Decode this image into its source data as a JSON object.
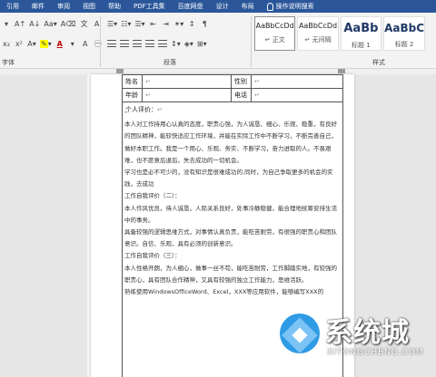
{
  "tabs": [
    "引用",
    "邮件",
    "审阅",
    "视图",
    "帮助",
    "PDF工具集",
    "百度网盘",
    "设计",
    "布局"
  ],
  "active_tab": "设计",
  "tell_me": "操作说明搜索",
  "ribbon": {
    "font_group_label": "字体",
    "paragraph_group_label": "段落",
    "styles_group_label": "样式",
    "styles": [
      {
        "sample": "AaBbCcDd",
        "name": "↵ 正文"
      },
      {
        "sample": "AaBbCcDd",
        "name": "↵ 无间隔"
      },
      {
        "sample": "AaBb",
        "name": "标题 1"
      },
      {
        "sample": "AaBbC",
        "name": "标题 2"
      }
    ]
  },
  "form": {
    "name_label": "姓名",
    "gender_label": "性别",
    "age_label": "年龄",
    "phone_label": "电话",
    "personal_eval": "个人评价："
  },
  "body": [
    "本人对工作持用心认真的态度，职责心强，为人诚恳、细心、乐观、稳重，有良好的团队精神，能较快适应工作环境，并能在实际工作中不断学习，不断完善自己，做好本职工作。我是一个用心、乐观、务实、不断学习，奋力进取的人。不畏艰难，也不愿意后退后，失去成功的一切机会。",
    "学习也是必不可少的，没有知识是很难成功的,同时，为自己争取更多的机会的实践，去成功",
    "工作自我评价（二）：",
    "本人作风优良，待人诚恳，人际关系良好，处事冷静稳健，能合理地统筹安排生活中的事务。",
    "具备较强的逻辑思维方式，对事情认真负责，能吃苦耐劳，有很强的职责心和团队意识。自信、乐观，具有必须的创新意识。",
    "工作自我评价（三）：",
    "本人性格开朗，为人细心，做事一丝不苟，能吃苦耐劳，工作脚踏实地，有较强的职责心，具有团队合作精神，又具有较强的独立工作能力，思维活跃。",
    "熟练使用WindowsOfficeWord、Excel，XXX等应用软件，能够编写XXX的"
  ],
  "watermark": {
    "title": "系统城",
    "url": "XITONGCHENG.COM"
  }
}
